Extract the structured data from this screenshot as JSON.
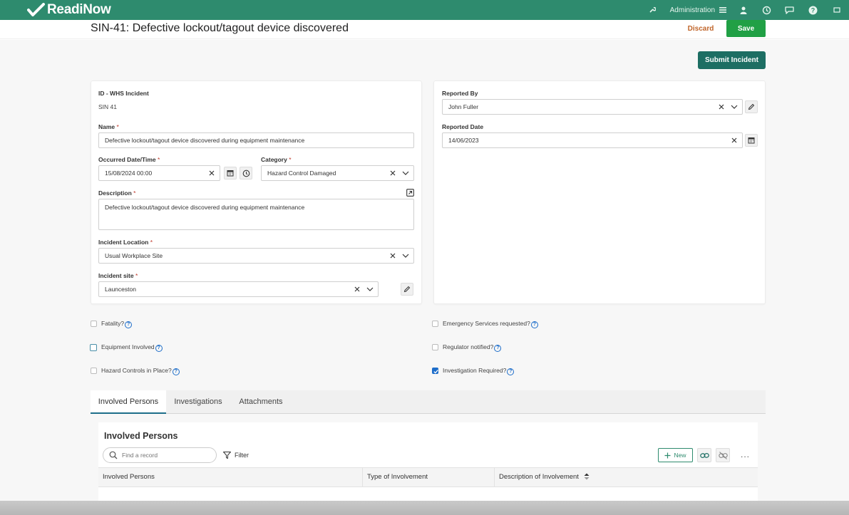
{
  "app": {
    "name": "ReadiNow",
    "brand_color": "#2e8b6e"
  },
  "topnav": {
    "admin_label": "Administration",
    "icons": [
      "wrench-icon",
      "menu-icon",
      "user-icon",
      "history-icon",
      "chat-icon",
      "help-icon",
      "fullscreen-icon"
    ]
  },
  "header": {
    "title": "SIN-41: Defective lockout/tagout device discovered",
    "discard_label": "Discard",
    "save_label": "Save"
  },
  "actions": {
    "submit_label": "Submit Incident"
  },
  "form": {
    "id_label": "ID - WHS Incident",
    "id_value": "SIN 41",
    "name_label": "Name",
    "name_value": "Defective lockout/tagout device discovered during equipment maintenance",
    "occurred_label": "Occurred Date/Time",
    "occurred_value": "15/08/2024 00:00",
    "category_label": "Category",
    "category_value": "Hazard Control Damaged",
    "description_label": "Description",
    "description_value": "Defective lockout/tagout device discovered during equipment maintenance",
    "location_label": "Incident Location",
    "location_value": "Usual Workplace Site",
    "site_label": "Incident site",
    "site_value": "Launceston",
    "reported_by_label": "Reported By",
    "reported_by_value": "John Fuller",
    "reported_date_label": "Reported Date",
    "reported_date_value": "14/06/2023",
    "required_mark": "*"
  },
  "checkboxes": {
    "fatality": {
      "label": "Fatality?",
      "checked": false
    },
    "equipment": {
      "label": "Equipment Involved",
      "checked": false
    },
    "hazard_controls": {
      "label": "Hazard Controls in Place?",
      "checked": false
    },
    "emergency": {
      "label": "Emergency Services requested?",
      "checked": false
    },
    "regulator": {
      "label": "Regulator notified?",
      "checked": false
    },
    "investigation": {
      "label": "Investigation Required?",
      "checked": true
    },
    "help_glyph": "?"
  },
  "tabs": [
    {
      "label": "Involved Persons",
      "active": true
    },
    {
      "label": "Investigations",
      "active": false
    },
    {
      "label": "Attachments",
      "active": false
    }
  ],
  "grid": {
    "title": "Involved Persons",
    "search_placeholder": "Find a record",
    "filter_label": "Filter",
    "new_label": "New",
    "more_label": "...",
    "columns": [
      "Involved Persons",
      "Type of Involvement",
      "Description of Involvement"
    ]
  }
}
